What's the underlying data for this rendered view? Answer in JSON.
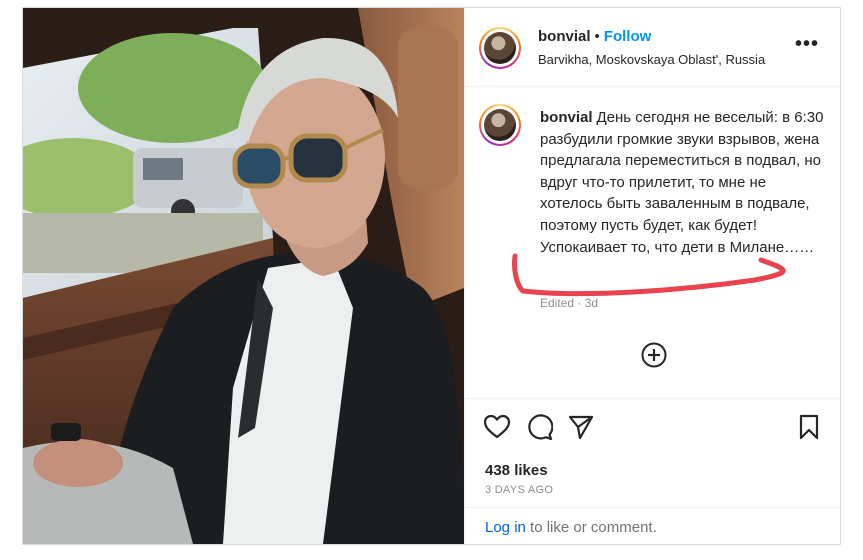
{
  "post": {
    "username": "bonvial",
    "separator": "•",
    "follow_label": "Follow",
    "location": "Barvikha, Moskovskaya Oblast', Russia",
    "more_label": "•••",
    "caption_text": "День сегодня не веселый: в 6:30 разбудили громкие звуки взрывов, жена предлагала переместиться в подвал, но вдруг что-то прилетит, то мне не хотелось быть заваленным в подвале, поэтому пусть будет, как будет! Успокаивает то, что дети в Милане……",
    "edited_meta": "Edited · 3d",
    "likes": "438 likes",
    "time_ago": "3 DAYS AGO",
    "login_link": "Log in",
    "login_suffix": " to like or comment."
  },
  "icons": {
    "like": "heart-icon",
    "comment": "comment-icon",
    "share": "send-icon",
    "save": "bookmark-icon",
    "add_comment": "plus-circle-icon",
    "more": "ellipsis-icon"
  },
  "colors": {
    "link": "#0095f6",
    "login": "#0064e0",
    "muted": "#8e8e8e",
    "annotation": "#e8434f"
  }
}
